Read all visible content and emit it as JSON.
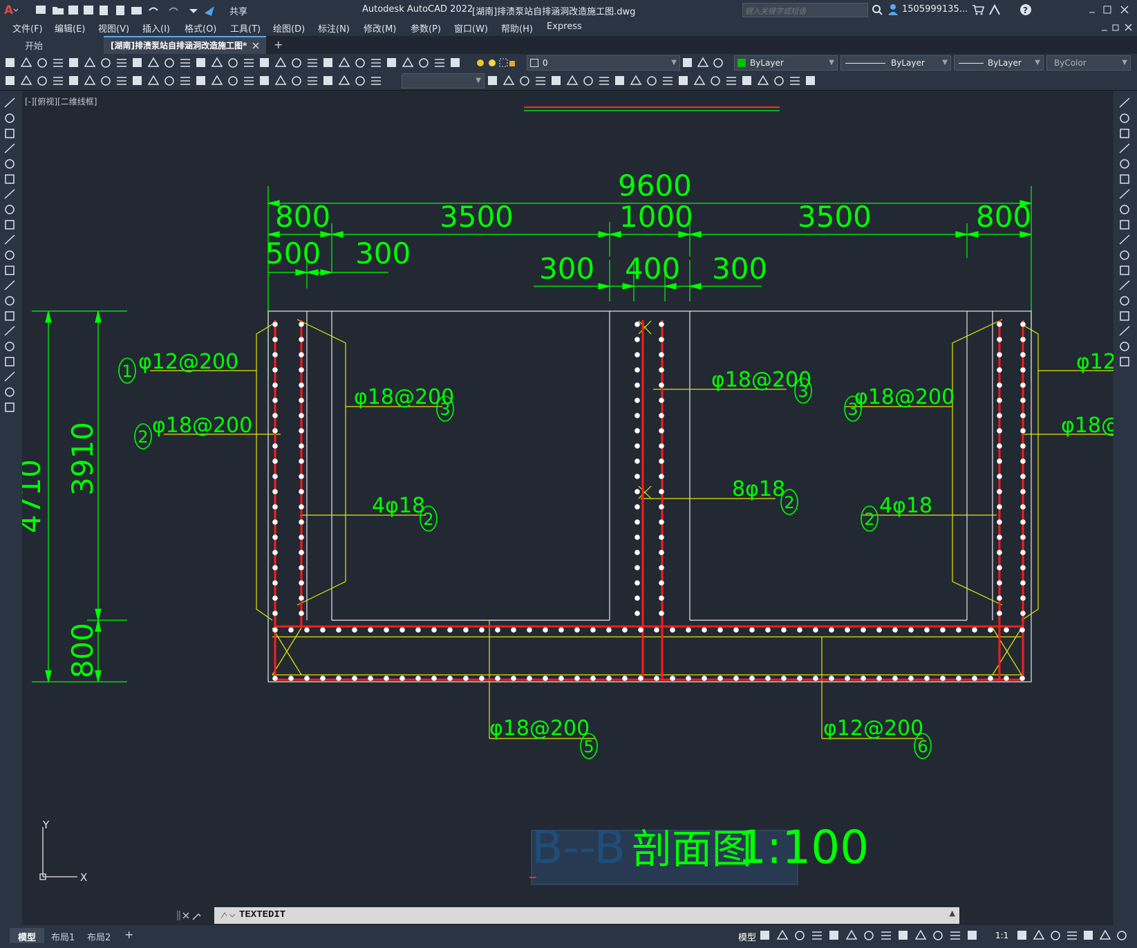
{
  "app": {
    "title": "Autodesk AutoCAD 2022",
    "document_title": "[湖南]排渍泵站自排涵洞改造施工图.dwg",
    "share_label": "共享",
    "search_placeholder": "键入关键字或短语",
    "user": "1505999135...",
    "accent": "#e04a3f"
  },
  "menu": [
    "文件(F)",
    "编辑(E)",
    "视图(V)",
    "插入(I)",
    "格式(O)",
    "工具(T)",
    "绘图(D)",
    "标注(N)",
    "修改(M)",
    "参数(P)",
    "窗口(W)",
    "帮助(H)",
    "Express"
  ],
  "tabs": {
    "start": "开始",
    "active": "[湖南]排渍泵站自排涵洞改造施工图*",
    "add": "+"
  },
  "properties": {
    "layer": "0",
    "color": "ByLayer",
    "color_swatch": "#00c000",
    "linetype": "ByLayer",
    "lineweight": "ByLayer",
    "plotstyle": "ByColor"
  },
  "viewport_label": "[-][俯视][二维线框]",
  "drawing": {
    "dimensions": {
      "total_width": "9600",
      "top_800_left": "800",
      "top_3500_left": "3500",
      "top_1000": "1000",
      "top_3500_right": "3500",
      "top_800_right": "800",
      "left_500": "500",
      "left_300": "300",
      "mid_300_left": "300",
      "mid_400": "400",
      "mid_300_right": "300",
      "height_4710": "4710",
      "height_3910": "3910",
      "height_800": "800"
    },
    "callouts": {
      "c1": "φ12@200",
      "c1_num": "1",
      "c2": "φ18@200",
      "c2_num": "2",
      "c3_left": "φ18@200",
      "c3_num": "3",
      "c4_left": "4φ18",
      "c4_num": "2",
      "c3_mid": "φ18@200",
      "c8_mid": "8φ18",
      "c3_right": "φ18@200",
      "c4_right": "4φ18",
      "edge_top": "φ12",
      "edge_bottom": "φ18@",
      "c5": "φ18@200",
      "c5_num": "5",
      "c6": "φ12@200",
      "c6_num": "6"
    },
    "section_title": {
      "prefix": "B--B",
      "name": "剖面图",
      "scale": "1:100"
    },
    "ucs": {
      "x": "X",
      "y": "Y"
    }
  },
  "command": {
    "text": "TEXTEDIT"
  },
  "layout_tabs": [
    "模型",
    "布局1",
    "布局2"
  ],
  "status": {
    "model": "模型",
    "scale": "1:1"
  }
}
